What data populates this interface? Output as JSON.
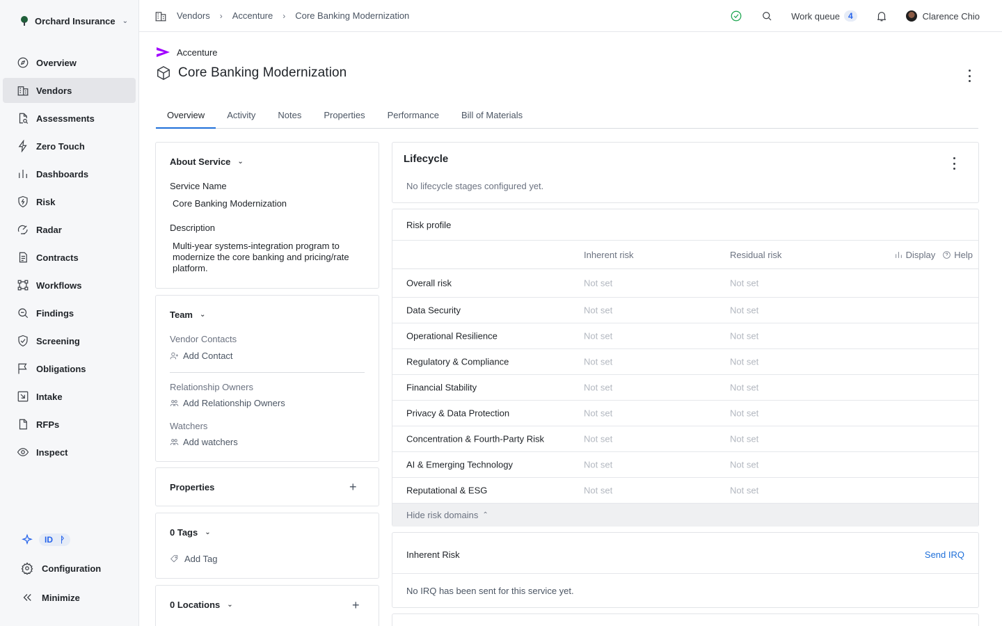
{
  "org": {
    "name": "Orchard Insurance"
  },
  "nav": [
    {
      "key": "overview",
      "label": "Overview",
      "icon": "compass-icon"
    },
    {
      "key": "vendors",
      "label": "Vendors",
      "icon": "building-icon"
    },
    {
      "key": "assessments",
      "label": "Assessments",
      "icon": "document-search-icon"
    },
    {
      "key": "zero-touch",
      "label": "Zero Touch",
      "icon": "lightning-icon"
    },
    {
      "key": "dashboards",
      "label": "Dashboards",
      "icon": "bar-chart-icon"
    },
    {
      "key": "risk",
      "label": "Risk",
      "icon": "shield-bolt-icon"
    },
    {
      "key": "radar",
      "label": "Radar",
      "icon": "radar-icon"
    },
    {
      "key": "contracts",
      "label": "Contracts",
      "icon": "contract-icon"
    },
    {
      "key": "workflows",
      "label": "Workflows",
      "icon": "workflow-icon"
    },
    {
      "key": "findings",
      "label": "Findings",
      "icon": "magnifier-icon"
    },
    {
      "key": "screening",
      "label": "Screening",
      "icon": "shield-check-icon"
    },
    {
      "key": "obligations",
      "label": "Obligations",
      "icon": "flag-icon"
    },
    {
      "key": "intake",
      "label": "Intake",
      "icon": "intake-icon"
    },
    {
      "key": "rfps",
      "label": "RFPs",
      "icon": "file-icon"
    },
    {
      "key": "inspect",
      "label": "Inspect",
      "icon": "eye-icon"
    }
  ],
  "sidebar_bottom": {
    "id_badge": "ID",
    "configuration": "Configuration",
    "minimize": "Minimize"
  },
  "breadcrumbs": [
    "Vendors",
    "Accenture",
    "Core Banking Modernization"
  ],
  "topbar": {
    "work_queue_label": "Work queue",
    "work_queue_count": "4",
    "user_name": "Clarence Chio"
  },
  "header": {
    "vendor": "Accenture",
    "title": "Core Banking Modernization"
  },
  "tabs": [
    "Overview",
    "Activity",
    "Notes",
    "Properties",
    "Performance",
    "Bill of Materials"
  ],
  "about": {
    "title": "About Service",
    "service_name_label": "Service Name",
    "service_name": "Core Banking Modernization",
    "description_label": "Description",
    "description": "Multi-year systems-integration program to modernize the core banking and pricing/rate platform."
  },
  "team": {
    "title": "Team",
    "vendor_contacts_label": "Vendor Contacts",
    "add_contact": "Add Contact",
    "relationship_owners_label": "Relationship Owners",
    "add_relationship_owners": "Add Relationship Owners",
    "watchers_label": "Watchers",
    "add_watchers": "Add watchers"
  },
  "properties": {
    "title": "Properties"
  },
  "tags": {
    "title": "0 Tags",
    "add_tag": "Add Tag"
  },
  "locations": {
    "title": "0 Locations"
  },
  "lifecycle": {
    "title": "Lifecycle",
    "empty": "No lifecycle stages configured yet."
  },
  "risk_profile": {
    "title": "Risk profile",
    "col_inherent": "Inherent risk",
    "col_residual": "Residual risk",
    "display": "Display",
    "help": "Help",
    "rows": [
      {
        "name": "Overall risk",
        "inherent": "Not set",
        "residual": "Not set"
      },
      {
        "name": "Data Security",
        "inherent": "Not set",
        "residual": "Not set"
      },
      {
        "name": "Operational Resilience",
        "inherent": "Not set",
        "residual": "Not set"
      },
      {
        "name": "Regulatory & Compliance",
        "inherent": "Not set",
        "residual": "Not set"
      },
      {
        "name": "Financial Stability",
        "inherent": "Not set",
        "residual": "Not set"
      },
      {
        "name": "Privacy & Data Protection",
        "inherent": "Not set",
        "residual": "Not set"
      },
      {
        "name": "Concentration & Fourth-Party Risk",
        "inherent": "Not set",
        "residual": "Not set"
      },
      {
        "name": "AI & Emerging Technology",
        "inherent": "Not set",
        "residual": "Not set"
      },
      {
        "name": "Reputational & ESG",
        "inherent": "Not set",
        "residual": "Not set"
      }
    ],
    "hide_domains": "Hide risk domains"
  },
  "inherent_risk": {
    "title": "Inherent Risk",
    "send_irq": "Send IRQ",
    "empty": "No IRQ has been sent for this service yet."
  },
  "colors": {
    "accent": "#1e6fd9",
    "status_ok": "#16a34a",
    "brand_accenture": "#a100ff"
  }
}
